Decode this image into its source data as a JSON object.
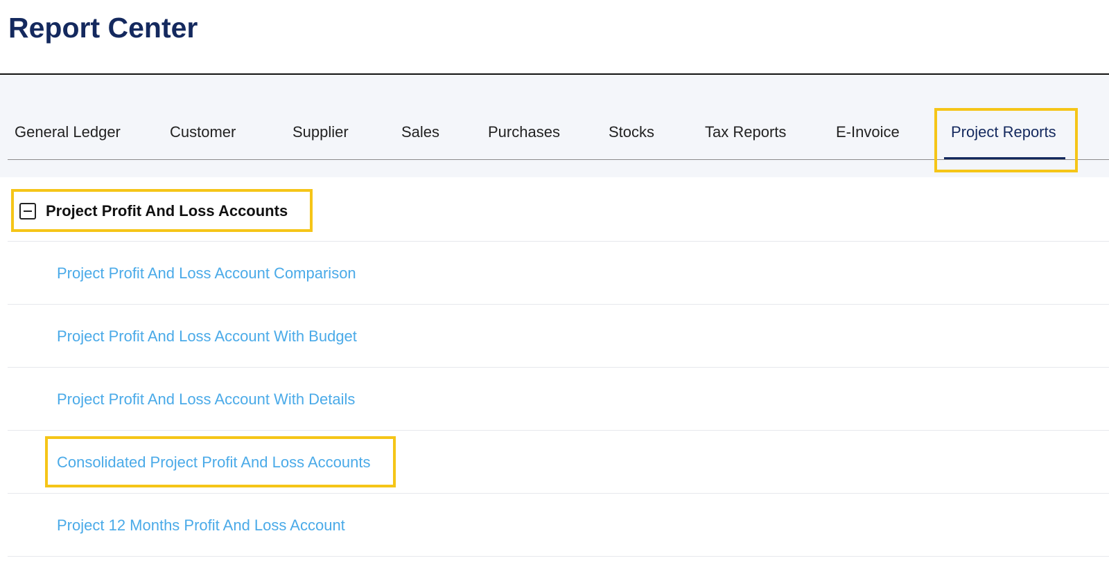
{
  "app": {
    "title": "Report Center"
  },
  "tabs": [
    {
      "label": "General Ledger",
      "active": false
    },
    {
      "label": "Customer",
      "active": false
    },
    {
      "label": "Supplier",
      "active": false
    },
    {
      "label": "Sales",
      "active": false
    },
    {
      "label": "Purchases",
      "active": false
    },
    {
      "label": "Stocks",
      "active": false
    },
    {
      "label": "Tax Reports",
      "active": false
    },
    {
      "label": "E-Invoice",
      "active": false
    },
    {
      "label": "Project Reports",
      "active": true
    }
  ],
  "group": {
    "label": "Project Profit And Loss Accounts",
    "expanded": true,
    "icon": "collapse-minus-icon",
    "items": [
      {
        "label": "Project Profit And Loss Account Comparison"
      },
      {
        "label": "Project Profit And Loss Account With Budget"
      },
      {
        "label": "Project Profit And Loss Account With Details"
      },
      {
        "label": "Consolidated Project Profit And Loss Accounts"
      },
      {
        "label": "Project 12 Months Profit And Loss Account"
      }
    ]
  },
  "colors": {
    "title": "#14295e",
    "active_tab": "#14295e",
    "link": "#4aaae8",
    "highlight": "#f5c518",
    "tabs_background": "#f4f6fa"
  }
}
